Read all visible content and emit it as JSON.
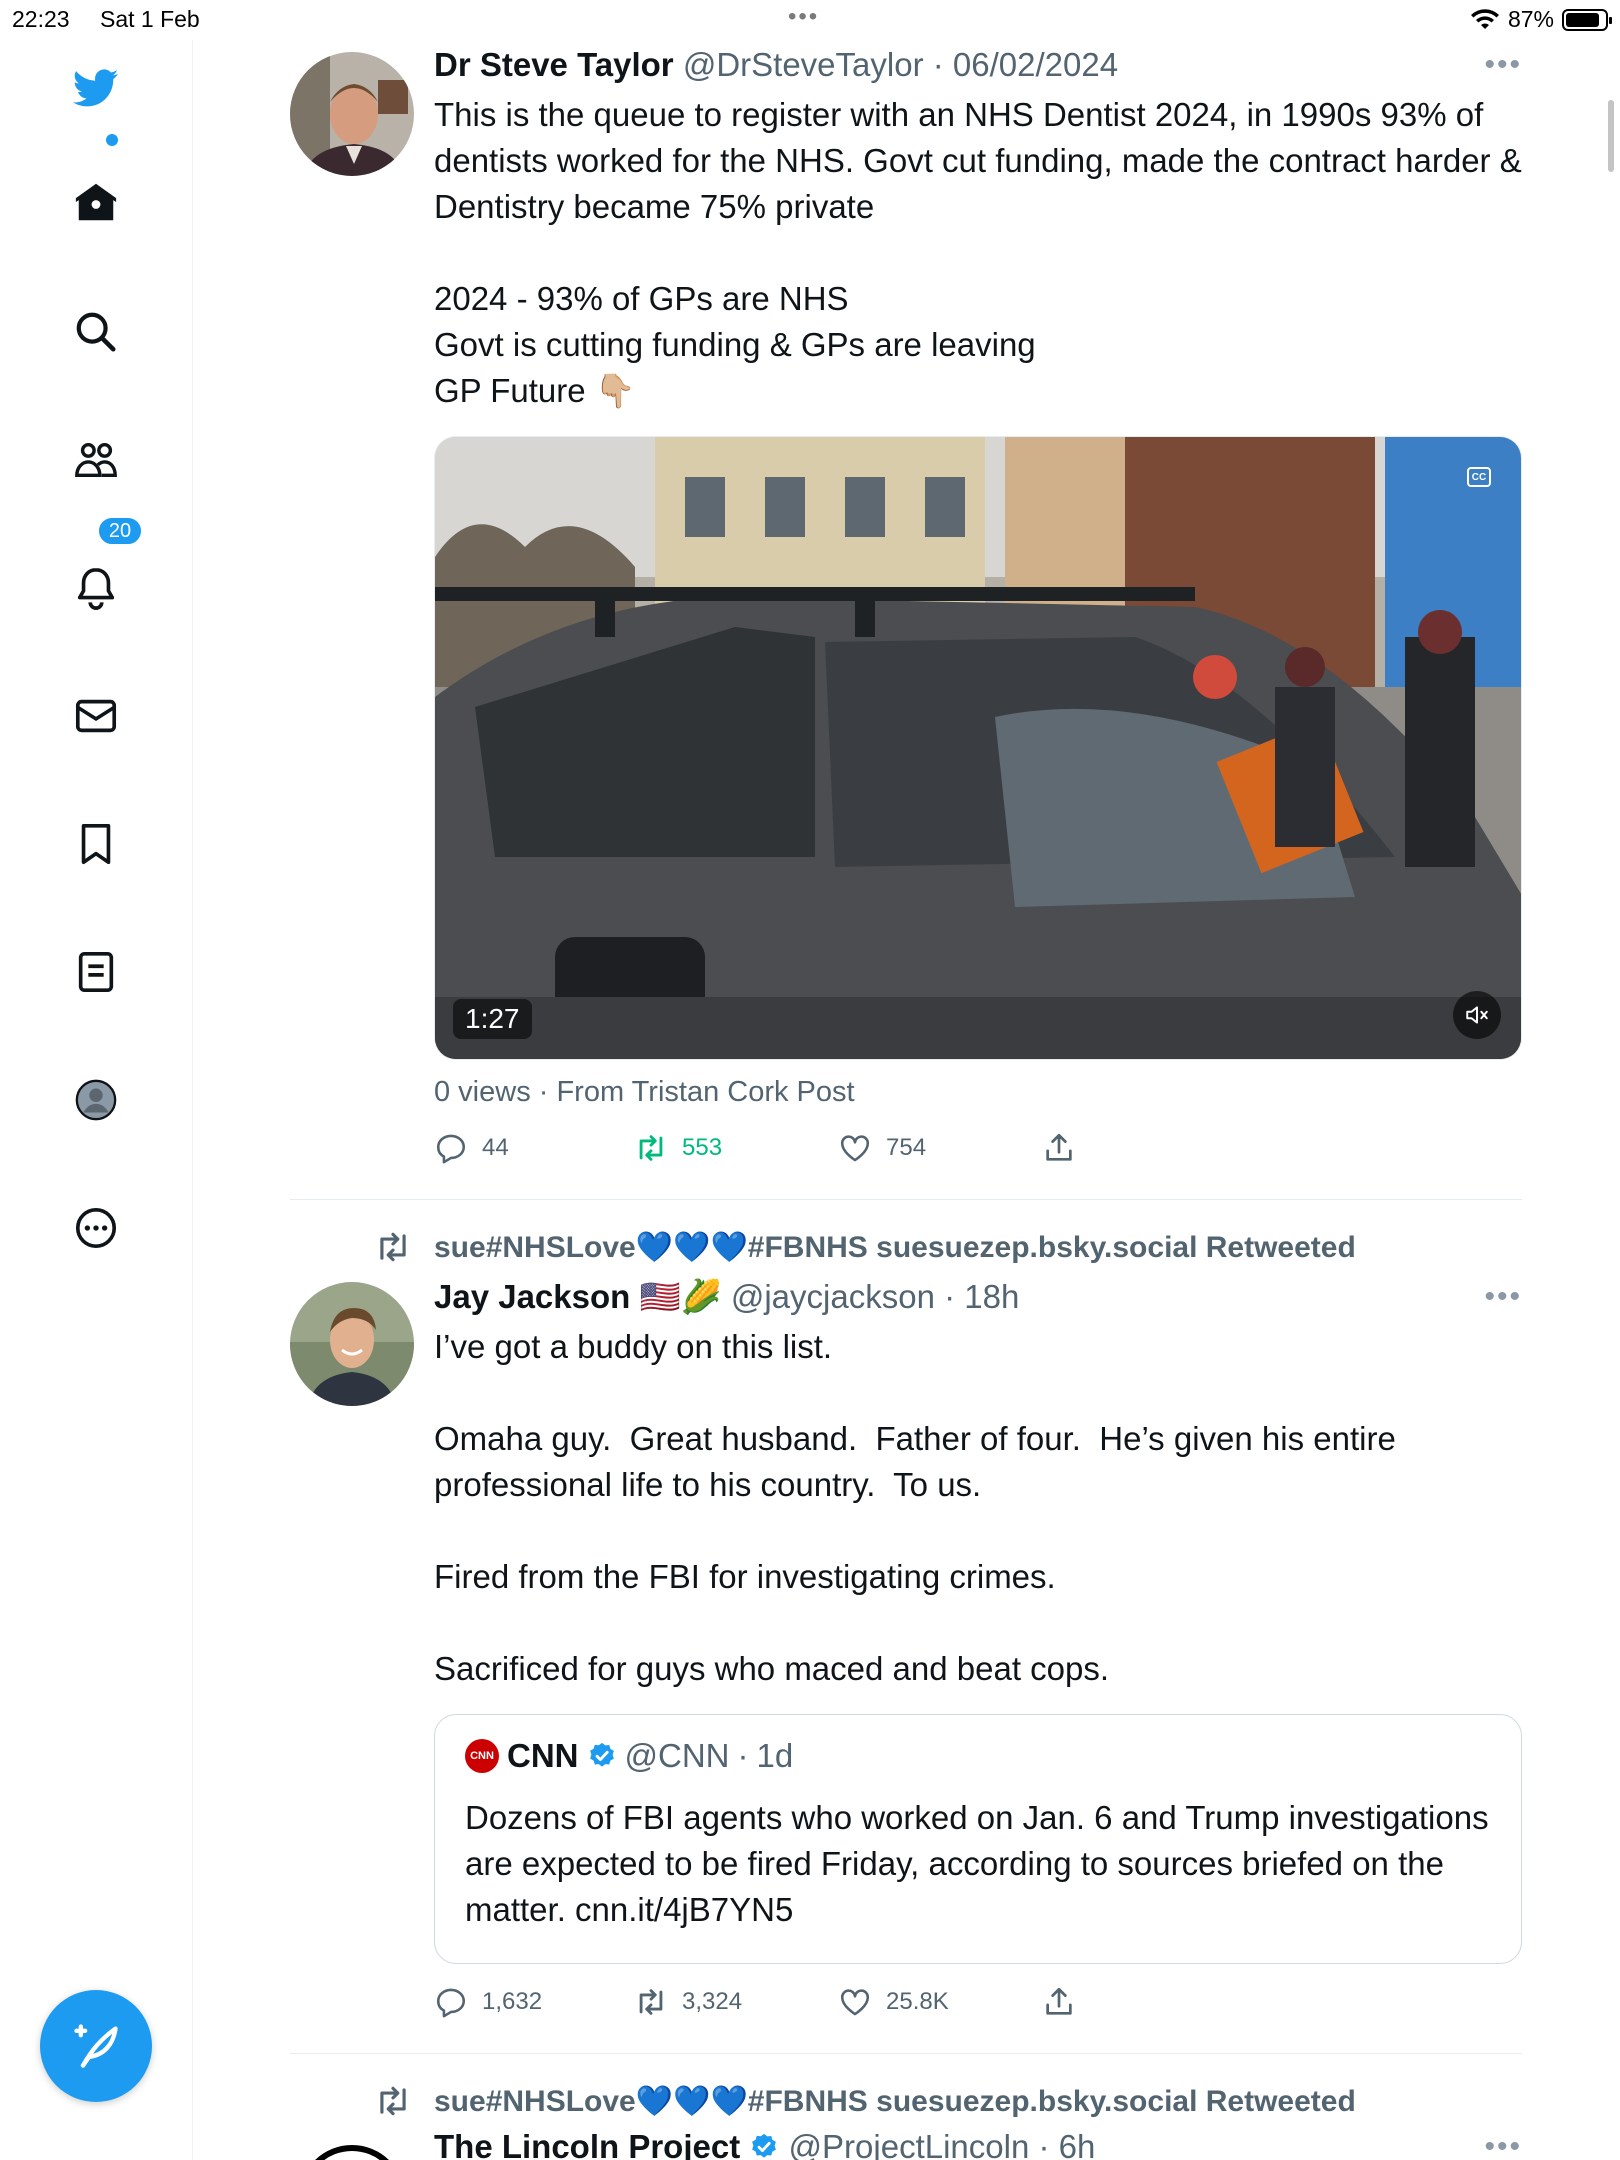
{
  "status": {
    "time": "22:23",
    "date": "Sat 1 Feb",
    "battery": "87%",
    "battery_level": 0.87
  },
  "sidebar": {
    "notifications_badge": "20"
  },
  "tweets": [
    {
      "name": "Dr Steve Taylor",
      "handle": "@DrSteveTaylor",
      "time": "06/02/2024",
      "text": "This is the queue to register with an NHS Dentist 2024, in 1990s 93% of dentists worked for the NHS. Govt cut funding, made the contract harder & Dentistry became 75% private\n\n2024 - 93% of GPs are NHS\nGovt is cutting funding & GPs are leaving\nGP Future 👇🏼",
      "video_duration": "1:27",
      "views_line": "0 views · From Tristan Cork Post",
      "replies": "44",
      "retweets": "553",
      "likes": "754"
    },
    {
      "retweeted_by": "sue#NHSLove💙💙💙#FBNHS suesuezep.bsky.social Retweeted",
      "name": "Jay Jackson",
      "name_emoji": "🇺🇸🌽",
      "handle": "@jaycjackson",
      "time": "18h",
      "text": "I’ve got a buddy on this list.\n\nOmaha guy.  Great husband.  Father of four.  He’s given his entire professional life to his country.  To us.\n\nFired from the FBI for investigating crimes.\n\nSacrificed for guys who maced and beat cops.",
      "quote": {
        "logo": "CNN",
        "name": "CNN",
        "handle": "@CNN",
        "time": "1d",
        "text": "Dozens of FBI agents who worked on Jan. 6 and Trump investigations are expected to be fired Friday, according to sources briefed on the matter. cnn.it/4jB7YN5"
      },
      "replies": "1,632",
      "retweets": "3,324",
      "likes": "25.8K"
    },
    {
      "retweeted_by": "sue#NHSLove💙💙💙#FBNHS suesuezep.bsky.social Retweeted",
      "name": "The Lincoln Project",
      "handle": "@ProjectLincoln",
      "time": "6h"
    }
  ],
  "colors": {
    "accent": "#1d9bf0",
    "retweet_active": "#00ba7c",
    "muted_text": "#536471"
  }
}
